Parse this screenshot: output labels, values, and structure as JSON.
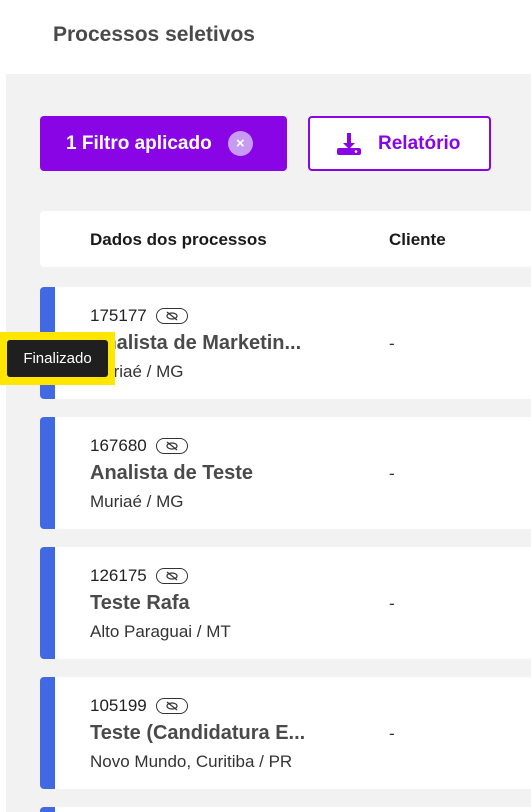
{
  "page": {
    "title": "Processos seletivos"
  },
  "toolbar": {
    "filter_label": "1 Filtro aplicado",
    "filter_clear_glyph": "×",
    "report_label": "Relatório"
  },
  "table": {
    "columns": {
      "dados": "Dados dos processos",
      "cliente": "Cliente"
    },
    "rows": [
      {
        "code": "175177",
        "title": "Analista de Marketin...",
        "location": "Muriaé / MG",
        "client": "-"
      },
      {
        "code": "167680",
        "title": "Analista de Teste",
        "location": "Muriaé / MG",
        "client": "-"
      },
      {
        "code": "126175",
        "title": "Teste Rafa",
        "location": "Alto Paraguai / MT",
        "client": "-"
      },
      {
        "code": "105199",
        "title": "Teste (Candidatura E...",
        "location": "Novo Mundo, Curitiba / PR",
        "client": "-"
      }
    ]
  },
  "tooltip": {
    "text": "Finalizado"
  },
  "colors": {
    "accent": "#8a05e6",
    "status_bar": "#4169e1",
    "highlight": "#ffe600"
  },
  "icons": {
    "report": "download-icon",
    "visibility": "eye-off-icon"
  }
}
